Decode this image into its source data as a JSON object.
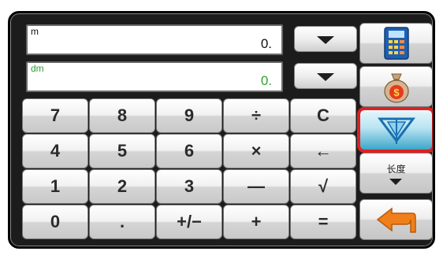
{
  "display": {
    "primary": {
      "unit": "m",
      "value": "0."
    },
    "secondary": {
      "unit": "dm",
      "value": "0."
    }
  },
  "keypad": {
    "rows": [
      [
        "7",
        "8",
        "9",
        "÷",
        "C"
      ],
      [
        "4",
        "5",
        "6",
        "×",
        "←"
      ],
      [
        "1",
        "2",
        "3",
        "—",
        "√"
      ],
      [
        "0",
        ".",
        "+/−",
        "+",
        "="
      ]
    ]
  },
  "sidebar": {
    "unit_type_label": "长度",
    "selected_mode": "conversion",
    "icons": [
      "calculator-icon",
      "money-bag-icon",
      "conversion-icon",
      "back-arrow-icon"
    ]
  },
  "colors": {
    "secondary_text": "#2ea12e",
    "selection_outline": "#e02020",
    "back_arrow": "#f07f1a"
  }
}
